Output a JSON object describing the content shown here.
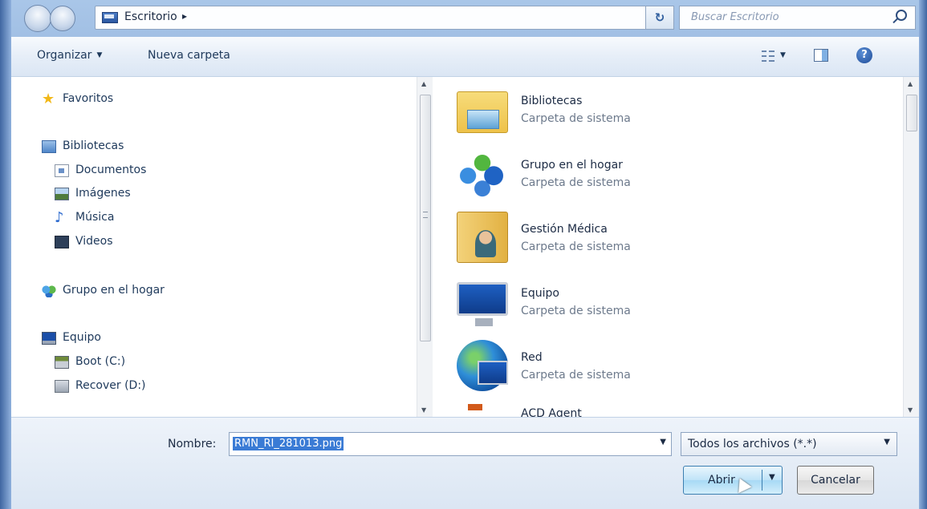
{
  "address_bar": {
    "location": "Escritorio",
    "search_placeholder": "Buscar Escritorio"
  },
  "toolbar": {
    "organize_label": "Organizar",
    "new_folder_label": "Nueva carpeta"
  },
  "nav_tree": {
    "favorites": "Favoritos",
    "libraries": "Bibliotecas",
    "library_items": [
      "Documentos",
      "Imágenes",
      "Música",
      "Videos"
    ],
    "homegroup": "Grupo en el hogar",
    "computer": "Equipo",
    "drives": [
      "Boot (C:)",
      "Recover (D:)"
    ]
  },
  "files": [
    {
      "name": "Bibliotecas",
      "type": "Carpeta de sistema",
      "icon": "libraries-folder-icon"
    },
    {
      "name": "Grupo en el hogar",
      "type": "Carpeta de sistema",
      "icon": "homegroup-icon"
    },
    {
      "name": "Gestión Médica",
      "type": "Carpeta de sistema",
      "icon": "user-folder-icon"
    },
    {
      "name": "Equipo",
      "type": "Carpeta de sistema",
      "icon": "computer-icon"
    },
    {
      "name": "Red",
      "type": "Carpeta de sistema",
      "icon": "network-icon"
    },
    {
      "name": "ACD Agent",
      "type": "",
      "icon": "acd-agent-icon"
    }
  ],
  "bottom": {
    "name_label": "Nombre:",
    "file_name": "RMN_RI_281013.png",
    "filter": "Todos los archivos (*.*)",
    "open_label": "Abrir",
    "cancel_label": "Cancelar"
  },
  "colors": {
    "frame": "#7fa4d4",
    "selection": "#3a7bd5",
    "text": "#1e395b"
  }
}
